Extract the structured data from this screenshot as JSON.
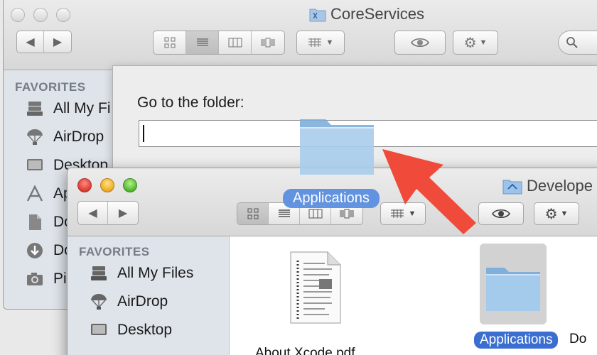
{
  "back_window": {
    "title": "CoreServices",
    "sidebar": {
      "heading": "FAVORITES",
      "items": [
        {
          "label": "All My Fi",
          "icon": "all-my-files-icon"
        },
        {
          "label": "AirDrop",
          "icon": "airdrop-icon"
        },
        {
          "label": "Desktop",
          "icon": "desktop-icon"
        },
        {
          "label": "Ap",
          "icon": "applications-icon"
        },
        {
          "label": "Do",
          "icon": "documents-icon"
        },
        {
          "label": "Do",
          "icon": "downloads-icon"
        },
        {
          "label": "Pi",
          "icon": "pictures-icon"
        }
      ]
    }
  },
  "goto_sheet": {
    "label": "Go to the folder:",
    "input_value": ""
  },
  "front_window": {
    "title": "Develope",
    "sidebar": {
      "heading": "FAVORITES",
      "items": [
        {
          "label": "All My Files",
          "icon": "all-my-files-icon"
        },
        {
          "label": "AirDrop",
          "icon": "airdrop-icon"
        },
        {
          "label": "Desktop",
          "icon": "desktop-icon"
        }
      ]
    },
    "files": [
      {
        "label": "About Xcode.pdf",
        "icon": "pdf-document-icon",
        "selected": false
      },
      {
        "label": "Applications",
        "icon": "folder-icon",
        "selected": true
      },
      {
        "label": "Do",
        "icon": "folder-icon",
        "selected": false
      }
    ]
  },
  "drag": {
    "label": "Applications",
    "icon": "folder-icon"
  },
  "colors": {
    "selection_blue": "#3a6fd1",
    "drag_label_blue": "#5b8fe0",
    "arrow_red": "#f04a3a",
    "folder_blue": "#8ebbe3",
    "sidebar_bg": "#dfe4ea"
  }
}
